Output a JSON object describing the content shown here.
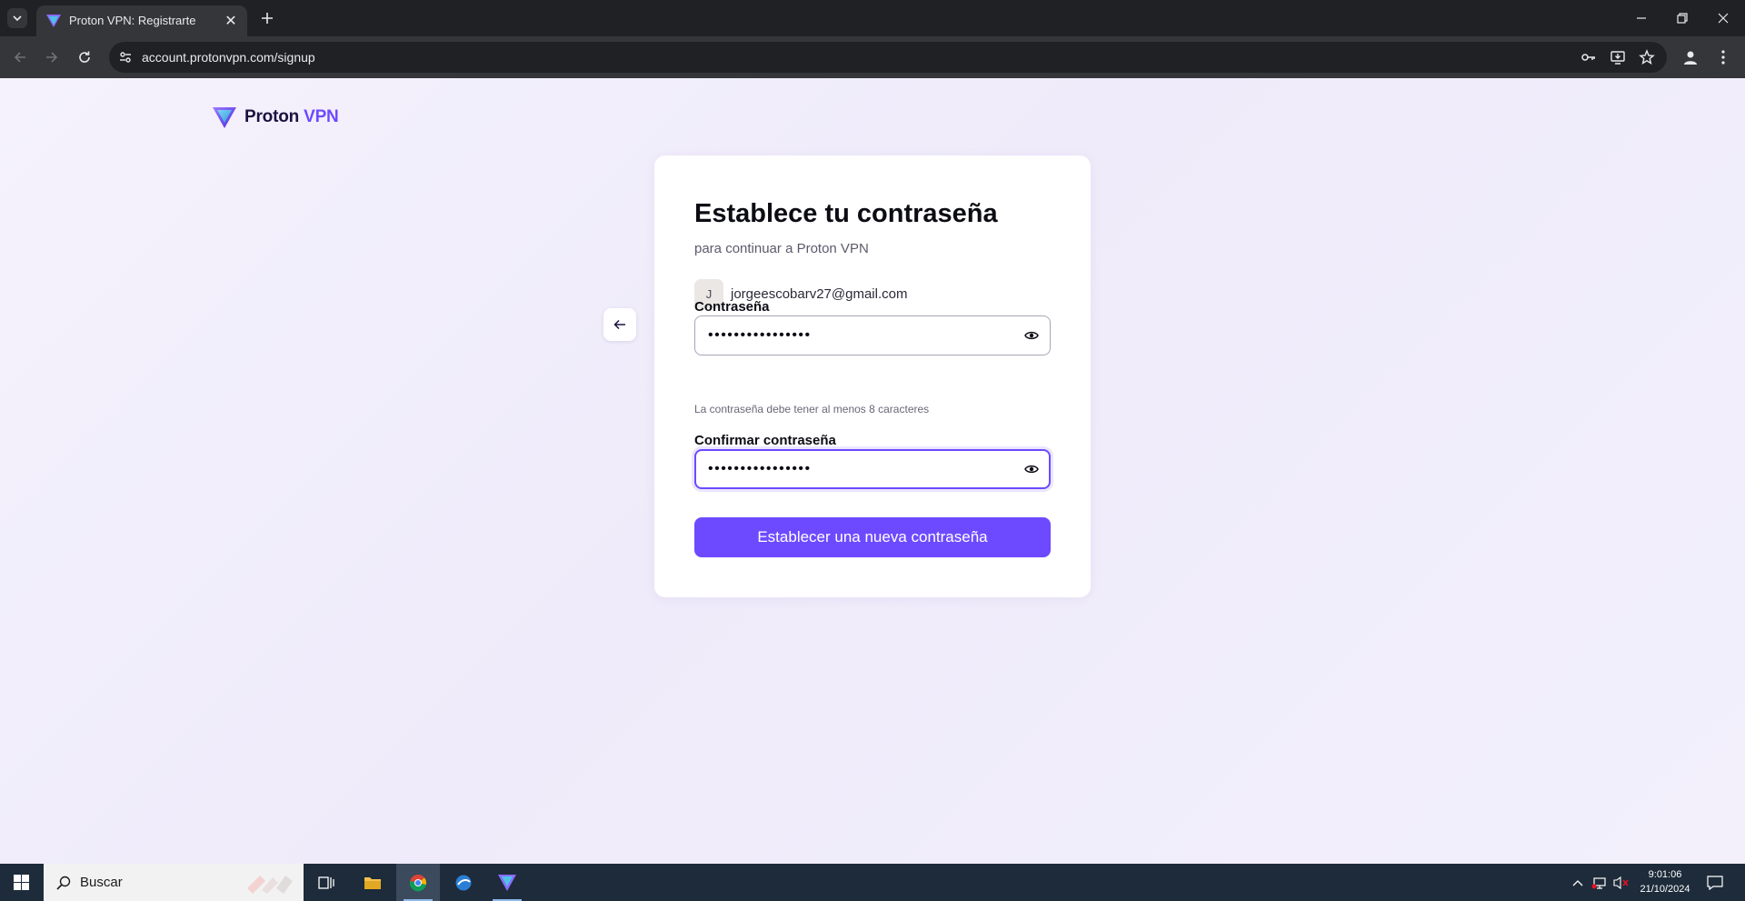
{
  "browser": {
    "tab_title": "Proton VPN: Registrarte",
    "url": "account.protonvpn.com/signup"
  },
  "page": {
    "logo_brand": "Proton",
    "logo_product": "VPN",
    "title": "Establece tu contraseña",
    "subtitle": "para continuar a Proton VPN",
    "avatar_initial": "J",
    "email": "jorgeescobarv27@gmail.com",
    "password_label": "Contraseña",
    "password_value": "••••••••••••••••",
    "password_hint": "La contraseña debe tener al menos 8 caracteres",
    "confirm_label": "Confirmar contraseña",
    "confirm_value": "••••••••••••••••",
    "submit_label": "Establecer una nueva contraseña"
  },
  "taskbar": {
    "search_placeholder": "Buscar",
    "time": "9:01:06",
    "date": "21/10/2024"
  },
  "colors": {
    "brand_accent": "#6d4aff",
    "page_background": "#f3f0fb",
    "taskbar": "#1d2b3a"
  }
}
